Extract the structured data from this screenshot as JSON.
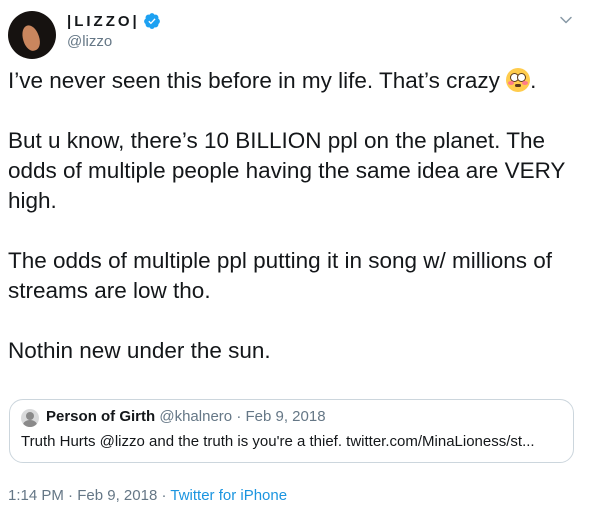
{
  "author": {
    "display_name": "|LIZZO|",
    "handle": "@lizzo",
    "verified": true,
    "avatar_icon": "profile-photo"
  },
  "tweet": {
    "paragraphs": [
      "I’ve never seen this before in my life. That’s crazy",
      "But u know, there’s 10 BILLION ppl on the planet. The odds of multiple people having the same idea are VERY high.",
      "The odds of multiple ppl putting it in song w/ millions of streams are low tho.",
      "Nothin new under the sun."
    ],
    "emoji": "flushed-face",
    "first_paragraph_end": "."
  },
  "quoted_tweet": {
    "display_name": "Person of Girth",
    "handle": "@khalnero",
    "separator": "·",
    "date": "Feb 9, 2018",
    "text": "Truth Hurts @lizzo and the truth is you're a thief. twitter.com/MinaLioness/st..."
  },
  "footer": {
    "time": "1:14 PM",
    "separator1": "·",
    "date": "Feb 9, 2018",
    "separator2": "·",
    "source": "Twitter for iPhone"
  },
  "colors": {
    "text": "#14171a",
    "secondary": "#657786",
    "link": "#1b95e0",
    "verified": "#1da1f2",
    "border": "#ccd6dd"
  }
}
